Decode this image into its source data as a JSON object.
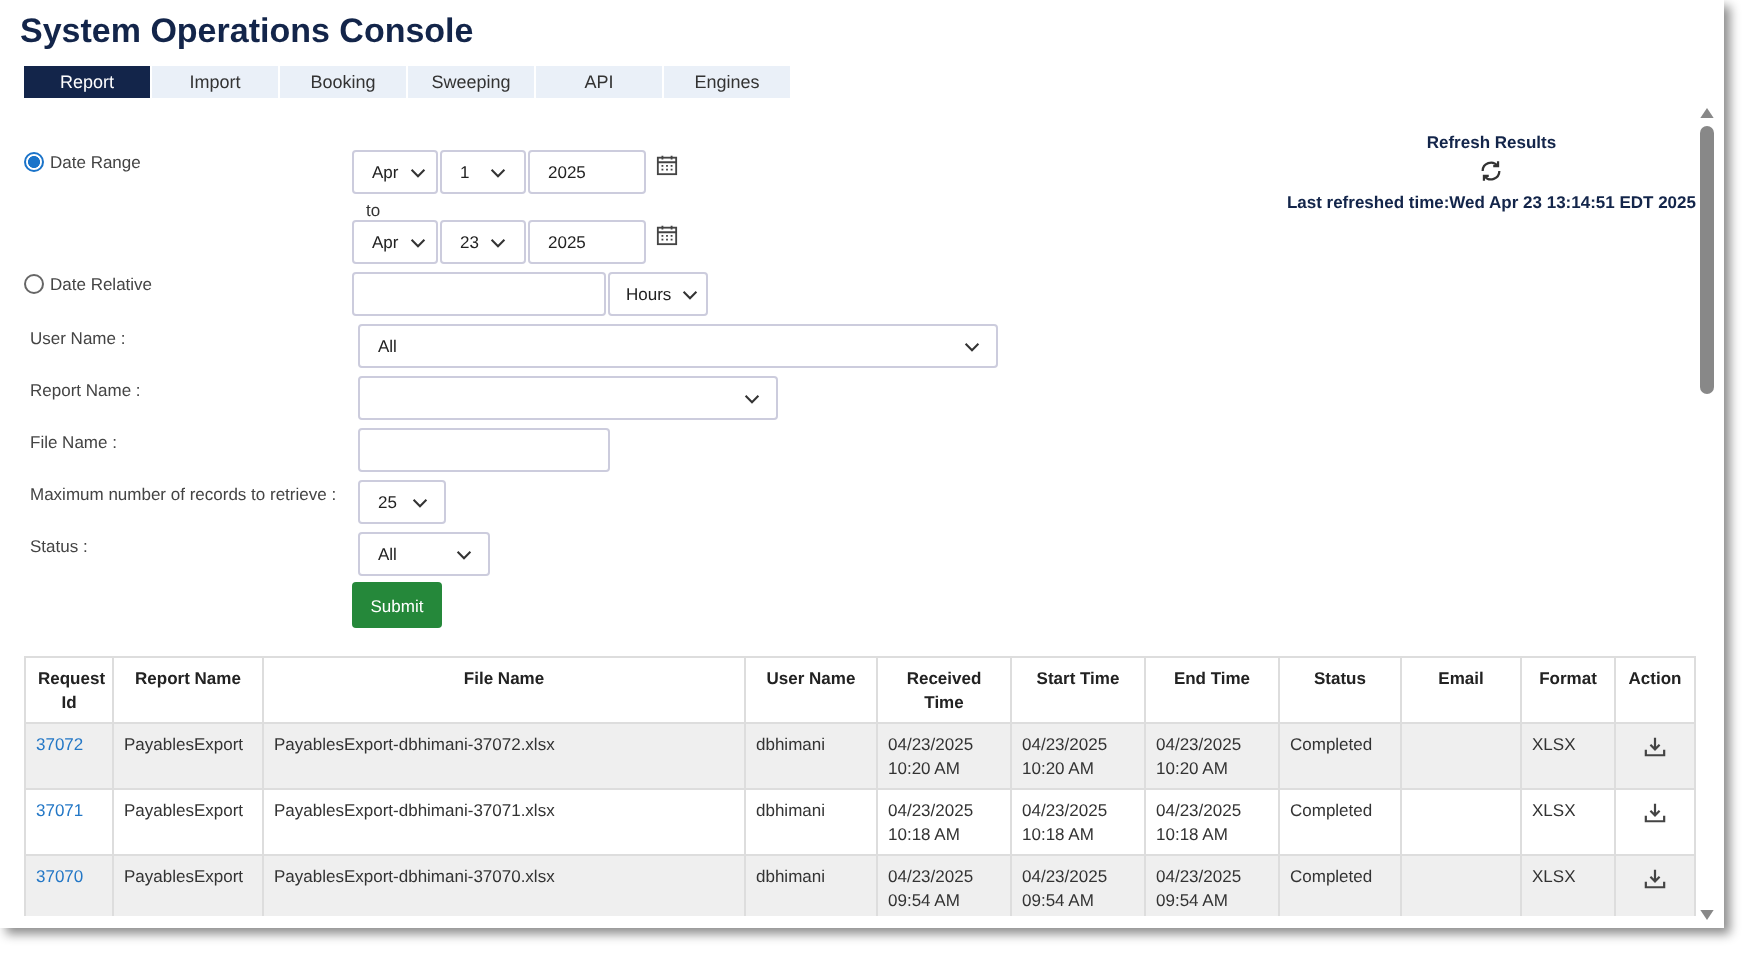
{
  "title": "System Operations Console",
  "tabs": [
    {
      "label": "Report",
      "selected": true
    },
    {
      "label": "Import",
      "selected": false
    },
    {
      "label": "Booking",
      "selected": false
    },
    {
      "label": "Sweeping",
      "selected": false
    },
    {
      "label": "API",
      "selected": false
    },
    {
      "label": "Engines",
      "selected": false
    }
  ],
  "refresh": {
    "label": "Refresh Results",
    "last_refreshed": "Last refreshed time:Wed Apr 23 13:14:51 EDT 2025"
  },
  "date_range": {
    "label": "Date Range",
    "selected": true,
    "from": {
      "month": "Apr",
      "day": "1",
      "year": "2025"
    },
    "to_label": "to",
    "to": {
      "month": "Apr",
      "day": "23",
      "year": "2025"
    }
  },
  "date_relative": {
    "label": "Date Relative",
    "selected": false,
    "unit": "Hours"
  },
  "fields": [
    {
      "label": "User Name :",
      "kind": "select",
      "value": "All"
    },
    {
      "label": "Report Name :",
      "kind": "select"
    },
    {
      "label": "File Name :",
      "kind": "text"
    },
    {
      "label": "Maximum number of records to retrieve :",
      "kind": "select",
      "value": "25"
    },
    {
      "label": "Status :",
      "kind": "select",
      "value": "All"
    }
  ],
  "submit": "Submit",
  "table": {
    "columns": [
      "Request Id",
      "Report Name",
      "File Name",
      "User Name",
      "Received Time",
      "Start Time",
      "End Time",
      "Status",
      "Email",
      "Format",
      "Action"
    ],
    "rows": [
      {
        "request_id": "37072",
        "report_name": "PayablesExport",
        "file_name": "PayablesExport-dbhimani-37072.xlsx",
        "user_name": "dbhimani",
        "received": "04/23/2025 10:20 AM",
        "start": "04/23/2025 10:20 AM",
        "end": "04/23/2025 10:20 AM",
        "status": "Completed",
        "format": "XLSX"
      },
      {
        "request_id": "37071",
        "report_name": "PayablesExport",
        "file_name": "PayablesExport-dbhimani-37071.xlsx",
        "user_name": "dbhimani",
        "received": "04/23/2025 10:18 AM",
        "start": "04/23/2025 10:18 AM",
        "end": "04/23/2025 10:18 AM",
        "status": "Completed",
        "format": "XLSX"
      },
      {
        "request_id": "37070",
        "report_name": "PayablesExport",
        "file_name": "PayablesExport-dbhimani-37070.xlsx",
        "user_name": "dbhimani",
        "received": "04/23/2025 09:54 AM",
        "start": "04/23/2025 09:54 AM",
        "end": "04/23/2025 09:54 AM",
        "status": "Completed",
        "format": "XLSX"
      }
    ]
  }
}
